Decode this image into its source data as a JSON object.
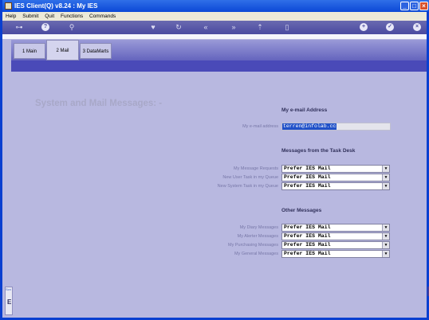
{
  "window": {
    "title": "IES Client(Q) v8.24 : My IES",
    "min": "_",
    "max": "□",
    "close": "×"
  },
  "menu": [
    "Help",
    "Submit",
    "Quit",
    "Functions",
    "Commands"
  ],
  "tabs": [
    {
      "label": "1 Main"
    },
    {
      "label": "2 Mail"
    },
    {
      "label": "3 DataMarts"
    }
  ],
  "page": {
    "heading": "System and Mail Messages: -",
    "email_section": {
      "title": "My e-mail Address",
      "label": "My e-mail address",
      "value": "terren@infolab.cc"
    },
    "task_section": {
      "title": "Messages from the Task Desk",
      "rows": [
        {
          "label": "My Message Requests",
          "value": "Prefer IES Mail"
        },
        {
          "label": "New User Task in my Queue",
          "value": "Prefer IES Mail"
        },
        {
          "label": "New System Task in my Queue",
          "value": "Prefer IES Mail"
        }
      ]
    },
    "other_section": {
      "title": "Other Messages",
      "rows": [
        {
          "label": "My Diary Messages",
          "value": "Prefer IES Mail"
        },
        {
          "label": "My Alerter Messages",
          "value": "Prefer IES Mail"
        },
        {
          "label": "My Purchasing Messages",
          "value": "Prefer IES Mail"
        },
        {
          "label": "My General Messages",
          "value": "Prefer IES Mail"
        }
      ]
    }
  },
  "side_tab": {
    "label": "Scn",
    "glyph": "E"
  },
  "colors": {
    "accent": "#4a4ab8",
    "background": "#b8b8e0",
    "selection": "#2050c8"
  }
}
